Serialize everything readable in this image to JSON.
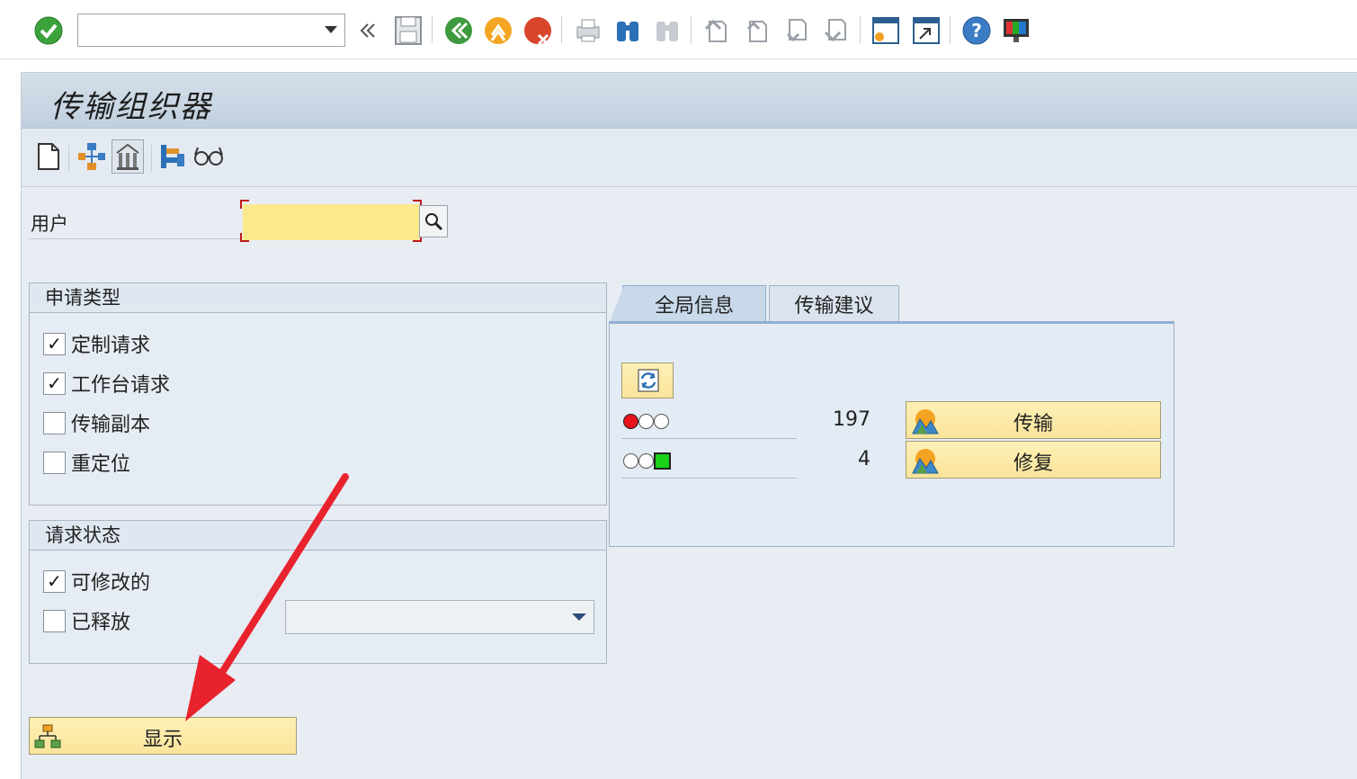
{
  "toolbar": {
    "command_field_value": "",
    "icons": [
      "enter-icon",
      "back-double-icon",
      "save-icon",
      "back-icon",
      "exit-icon",
      "cancel-icon",
      "print-icon",
      "find-icon",
      "find-next-icon",
      "first-page-icon",
      "previous-page-icon",
      "next-page-icon",
      "last-page-icon",
      "create-session-icon",
      "shortcut-icon",
      "help-icon",
      "customize-layout-icon"
    ]
  },
  "page": {
    "title": "传输组织器"
  },
  "app_toolbar": {
    "icons": [
      "new-document-icon",
      "transport-route-icon",
      "transport-system-icon",
      "workbench-tools-icon",
      "display-glasses-icon"
    ]
  },
  "user": {
    "label": "用户",
    "value": ""
  },
  "request_type": {
    "title": "申请类型",
    "options": [
      {
        "label": "定制请求",
        "checked": true
      },
      {
        "label": "工作台请求",
        "checked": true
      },
      {
        "label": "传输副本",
        "checked": false
      },
      {
        "label": "重定位",
        "checked": false
      }
    ]
  },
  "request_status": {
    "title": "请求状态",
    "options": [
      {
        "label": "可修改的",
        "checked": true
      },
      {
        "label": "已释放",
        "checked": false
      }
    ],
    "released_select_value": ""
  },
  "tabs": [
    {
      "label": "全局信息",
      "active": true
    },
    {
      "label": "传输建议",
      "active": false
    }
  ],
  "global_info": {
    "rows": [
      {
        "status": "red",
        "count": "197",
        "button_label": "传输"
      },
      {
        "status": "green",
        "count": "4",
        "button_label": "修复"
      }
    ]
  },
  "display_button": {
    "label": "显示"
  },
  "colors": {
    "required_field": "#fce98c",
    "button_yellow": "#fae49a",
    "title_bar": "#c1d0de",
    "annotation_arrow": "#e8232d"
  }
}
